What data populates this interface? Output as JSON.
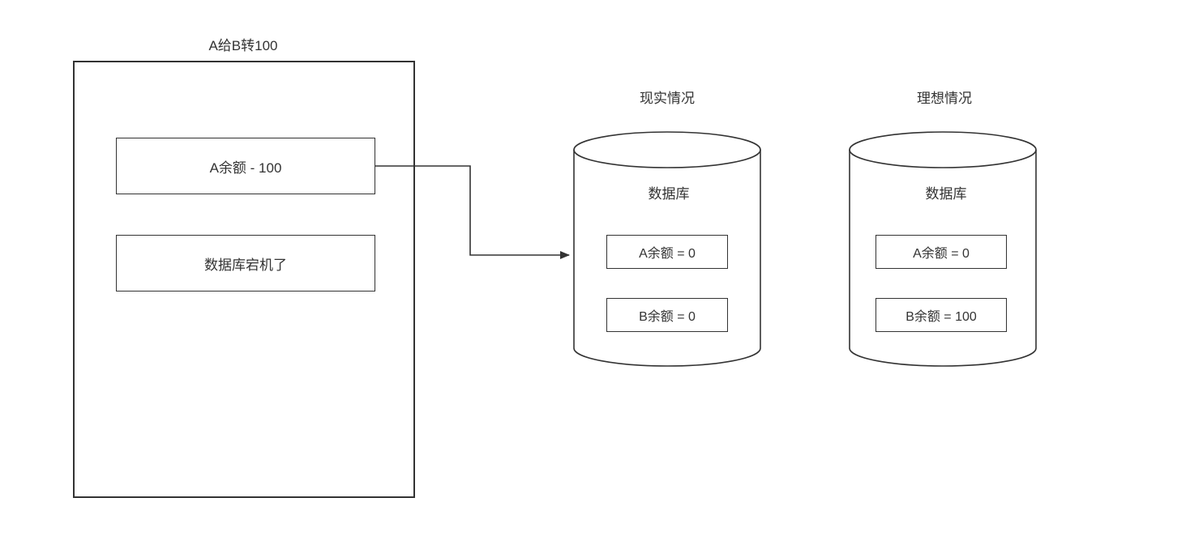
{
  "colors": {
    "stroke": "#333333",
    "bg": "#ffffff"
  },
  "transaction": {
    "title": "A给B转100",
    "step1": "A余额 - 100",
    "step2": "数据库宕机了"
  },
  "databases": {
    "actual": {
      "title": "现实情况",
      "label": "数据库",
      "row1": "A余额 = 0",
      "row2": "B余额 = 0"
    },
    "ideal": {
      "title": "理想情况",
      "label": "数据库",
      "row1": "A余额 = 0",
      "row2": "B余额 = 100"
    }
  }
}
